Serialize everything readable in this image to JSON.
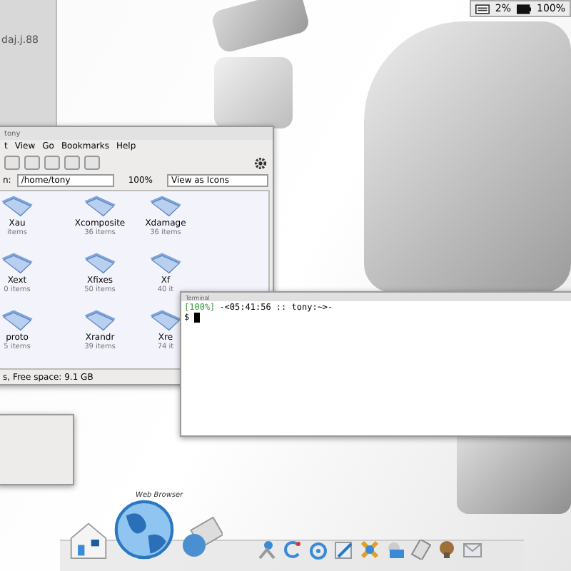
{
  "top_panel": {
    "reading_1": "2%",
    "battery": "100%"
  },
  "desktop_widget": {
    "text": "daj.j.88"
  },
  "file_manager": {
    "title": "tony",
    "menu": [
      "t",
      "View",
      "Go",
      "Bookmarks",
      "Help"
    ],
    "location_label": "n:",
    "path": "/home/tony",
    "zoom": "100%",
    "view_mode": "View as Icons",
    "items": [
      {
        "name": "Xau",
        "count": "items"
      },
      {
        "name": "Xcomposite",
        "count": "36 items"
      },
      {
        "name": "Xdamage",
        "count": "36 items"
      },
      {
        "name": "Xext",
        "count": "0 items"
      },
      {
        "name": "Xfixes",
        "count": "50 items"
      },
      {
        "name": "Xf",
        "count": "40 it"
      },
      {
        "name": "proto",
        "count": "5 items"
      },
      {
        "name": "Xrandr",
        "count": "39 items"
      },
      {
        "name": "Xre",
        "count": "74 it"
      }
    ],
    "status": "s, Free space: 9.1 GB"
  },
  "terminal": {
    "title": "Terminal",
    "lines": [
      {
        "kind": "prompt",
        "badge": "[100%]",
        "text": "-<05:41:56 :: tony:~>-"
      },
      {
        "kind": "input",
        "text": "$"
      }
    ]
  },
  "dock": {
    "label": "Web Browser"
  }
}
